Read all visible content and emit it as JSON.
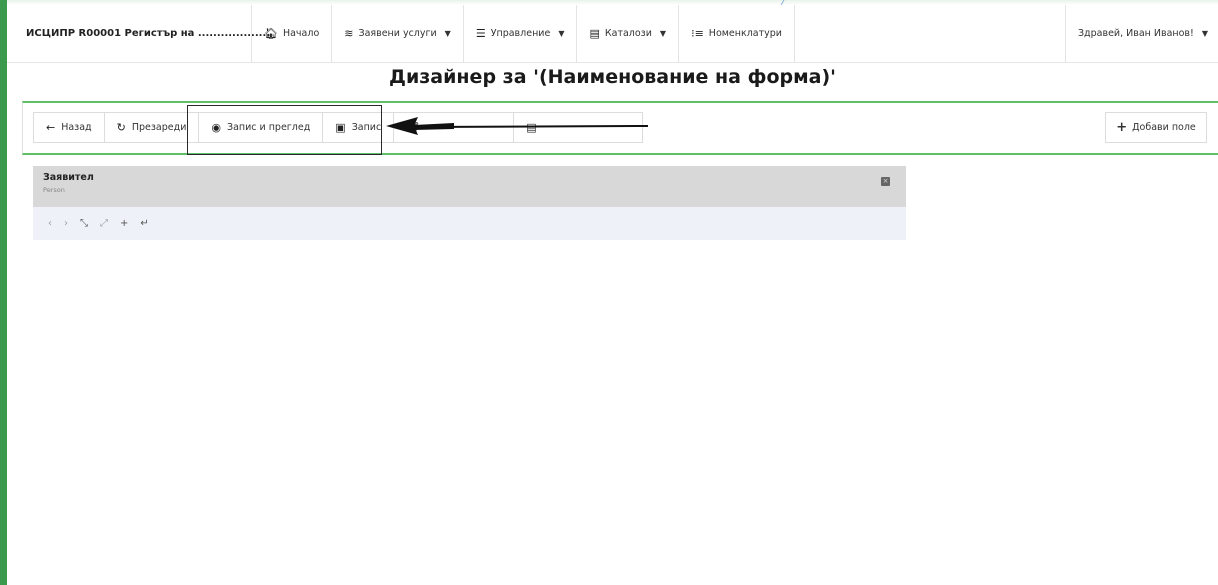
{
  "brand": {
    "title": "ИСЦИПР R00001 Регистър на ..................."
  },
  "nav": {
    "items": [
      {
        "label": "Начало",
        "icon": "home-icon",
        "glyph": "⌂",
        "dropdown": false
      },
      {
        "label": "Заявени услуги",
        "icon": "layers-icon",
        "glyph": "≋",
        "dropdown": true
      },
      {
        "label": "Управление",
        "icon": "sliders-icon",
        "glyph": "☰",
        "dropdown": true
      },
      {
        "label": "Каталози",
        "icon": "table-icon",
        "glyph": "▤",
        "dropdown": true
      },
      {
        "label": "Номенклатури",
        "icon": "list-icon",
        "glyph": "⁝≡",
        "dropdown": false
      }
    ],
    "user_greeting": "Здравей, Иван Иванов!"
  },
  "page": {
    "title": "Дизайнер за '(Наименование на форма)'"
  },
  "toolbar": {
    "back_label": "Назад",
    "reload_label": "Презареди",
    "save_preview_label": "Запис и преглед",
    "save_label": "Запис",
    "add_field_label": "Добави поле"
  },
  "panel": {
    "title": "Заявител",
    "subtitle": "Person"
  },
  "colors": {
    "accent_green": "#5fbf6b",
    "frame_green": "#3b9a4d",
    "panel_header": "#d8d8d8",
    "panel_body": "#eef2f8"
  }
}
